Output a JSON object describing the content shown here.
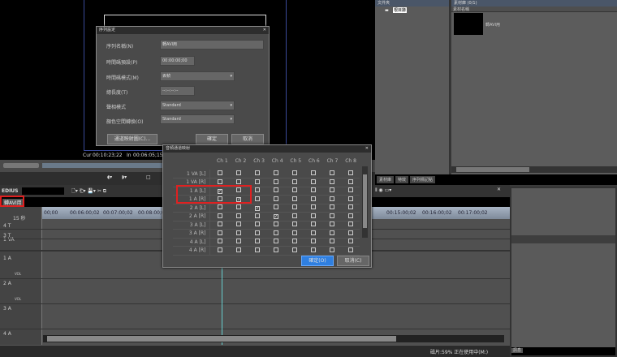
{
  "preview": {
    "cur_label": "Cur",
    "cur_value": "00:10:23;22",
    "in_label": "In",
    "in_value": "00:06:05;15"
  },
  "app": {
    "brand": "EDIUS",
    "sequence_tab": "轉AVI用"
  },
  "sequence_dialog": {
    "title": "序列設定",
    "name_label": "序列名稱(N)",
    "name_value": "轉AVI用",
    "tc_preset_label": "時間碼預設(P)",
    "tc_preset_value": "00:00:00;00",
    "tc_mode_label": "時間碼模式(M)",
    "tc_mode_value": "丟幀",
    "duration_label": "總長度(T)",
    "duration_value": "--:--:--:--",
    "field_label": "聲相模式",
    "field_value": "Standard",
    "color_label": "顏色空間轉換(O)",
    "color_value": "Standard",
    "channel_map_button": "通道映射圖(C)...",
    "ok": "確定",
    "cancel": "取消"
  },
  "audio_map": {
    "title": "音頻通道映射",
    "channels": [
      "Ch 1",
      "Ch 2",
      "Ch 3",
      "Ch 4",
      "Ch 5",
      "Ch 6",
      "Ch 7",
      "Ch 8"
    ],
    "rows": [
      {
        "label": "1 VA [L]",
        "checked": []
      },
      {
        "label": "1 VA [R]",
        "checked": []
      },
      {
        "label": "1 A [L]",
        "checked": [
          1
        ]
      },
      {
        "label": "1 A [R]",
        "checked": [
          2
        ]
      },
      {
        "label": "2 A [L]",
        "checked": [
          3
        ]
      },
      {
        "label": "2 A [R]",
        "checked": [
          4
        ]
      },
      {
        "label": "3 A [L]",
        "checked": []
      },
      {
        "label": "3 A [R]",
        "checked": []
      },
      {
        "label": "4 A [L]",
        "checked": []
      },
      {
        "label": "4 A [R]",
        "checked": []
      }
    ],
    "ok": "確定(O)",
    "cancel": "取消(C)"
  },
  "bin": {
    "title": "文件夾",
    "root": "根目錄",
    "clip_title": "素材庫 (0/1)",
    "clip_header": "素材名稱",
    "clip_name": "轉AVI用",
    "tabs": [
      "素材庫",
      "特效",
      "序列標記點"
    ]
  },
  "timeline": {
    "scale": "15 秒",
    "ruler": [
      "00;00",
      "00:06:00;02",
      "00:07:00;02",
      "00:08:00;02",
      "00:15:00;02",
      "00:16:00;02",
      "00:17:00;02"
    ],
    "tracks": [
      "4 T",
      "3 T",
      "1 VA",
      "1 A",
      "2 A",
      "3 A",
      "4 A"
    ],
    "vol": "VOL"
  },
  "status": {
    "disk": "磁片:59% 正在使用中(M:)"
  },
  "right_panel": {
    "label": "訊息"
  },
  "colors": {
    "accent": "#2f7fe0",
    "highlight": "#e02020",
    "ruler": "#a8b4c4"
  }
}
